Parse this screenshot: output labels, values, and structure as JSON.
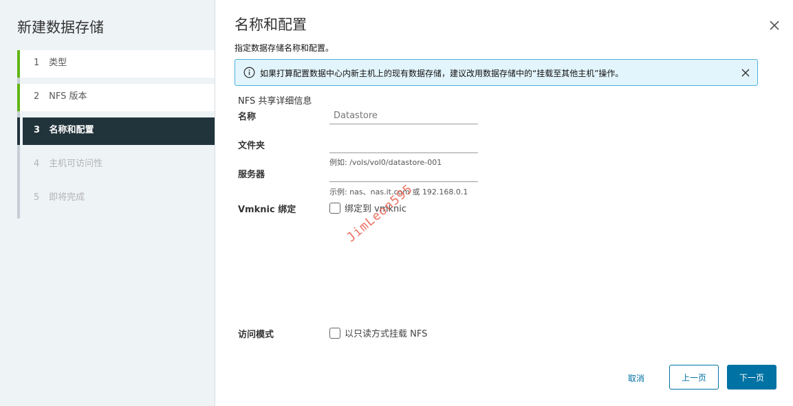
{
  "wizard": {
    "title": "新建数据存储",
    "steps": [
      {
        "num": "1",
        "label": "类型"
      },
      {
        "num": "2",
        "label": "NFS 版本"
      },
      {
        "num": "3",
        "label": "名称和配置"
      },
      {
        "num": "4",
        "label": "主机可访问性"
      },
      {
        "num": "5",
        "label": "即将完成"
      }
    ]
  },
  "page": {
    "title": "名称和配置",
    "subtitle": "指定数据存储名称和配置。"
  },
  "alert": {
    "text": "如果打算配置数据中心内新主机上的现有数据存储，建议改用数据存储中的“挂载至其他主机”操作。"
  },
  "form": {
    "section_title": "NFS 共享详细信息",
    "name_label": "名称",
    "name_value": "Datastore",
    "folder_label": "文件夹",
    "folder_value": "",
    "folder_hint": "例如: /vols/vol0/datastore-001",
    "server_label": "服务器",
    "server_value": "",
    "server_hint": "示例: nas、nas.it.com 或 192.168.0.1",
    "vmknic_label": "Vmknic 绑定",
    "vmknic_checkbox": "绑定到 vmknic",
    "access_label": "访问模式",
    "access_checkbox": "以只读方式挂载 NFS"
  },
  "watermark": "JimLeon595",
  "footer": {
    "cancel": "取消",
    "back": "上一页",
    "next": "下一页"
  },
  "colors": {
    "sidebar_bg": "#eef3f6",
    "active_step": "#21333b",
    "complete_accent": "#60b515",
    "primary": "#0072a3",
    "alert_bg": "#e3f5fc",
    "alert_border": "#49afd9"
  }
}
